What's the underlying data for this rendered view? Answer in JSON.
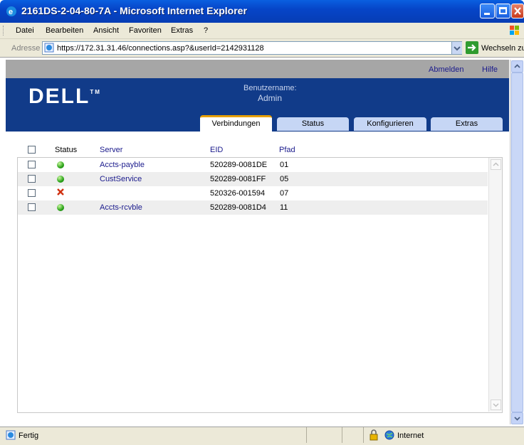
{
  "window": {
    "title": "2161DS-2-04-80-7A - Microsoft Internet Explorer"
  },
  "menu": {
    "items": [
      "Datei",
      "Bearbeiten",
      "Ansicht",
      "Favoriten",
      "Extras",
      "?"
    ]
  },
  "address": {
    "label": "Adresse",
    "url": "https://172.31.31.46/connections.asp?&userId=2142931128",
    "go_label": "Wechseln zu"
  },
  "toplinks": {
    "logout": "Abmelden",
    "help": "Hilfe"
  },
  "header": {
    "logo": "DELL",
    "user_label": "Benutzername:",
    "user_value": "Admin"
  },
  "tabs": [
    {
      "label": "Verbindungen",
      "active": true
    },
    {
      "label": "Status",
      "active": false
    },
    {
      "label": "Konfigurieren",
      "active": false
    },
    {
      "label": "Extras",
      "active": false
    }
  ],
  "table": {
    "columns": [
      "Status",
      "Server",
      "EID",
      "Pfad"
    ],
    "rows": [
      {
        "status": "online",
        "server": "Accts-payble",
        "eid": "520289-0081DE",
        "path": "01"
      },
      {
        "status": "online",
        "server": "CustService",
        "eid": "520289-0081FF",
        "path": "05"
      },
      {
        "status": "offline",
        "server": "",
        "eid": "520326-001594",
        "path": "07"
      },
      {
        "status": "online",
        "server": "Accts-rcvble",
        "eid": "520289-0081D4",
        "path": "11"
      }
    ]
  },
  "statusbar": {
    "left": "Fertig",
    "zone": "Internet"
  }
}
